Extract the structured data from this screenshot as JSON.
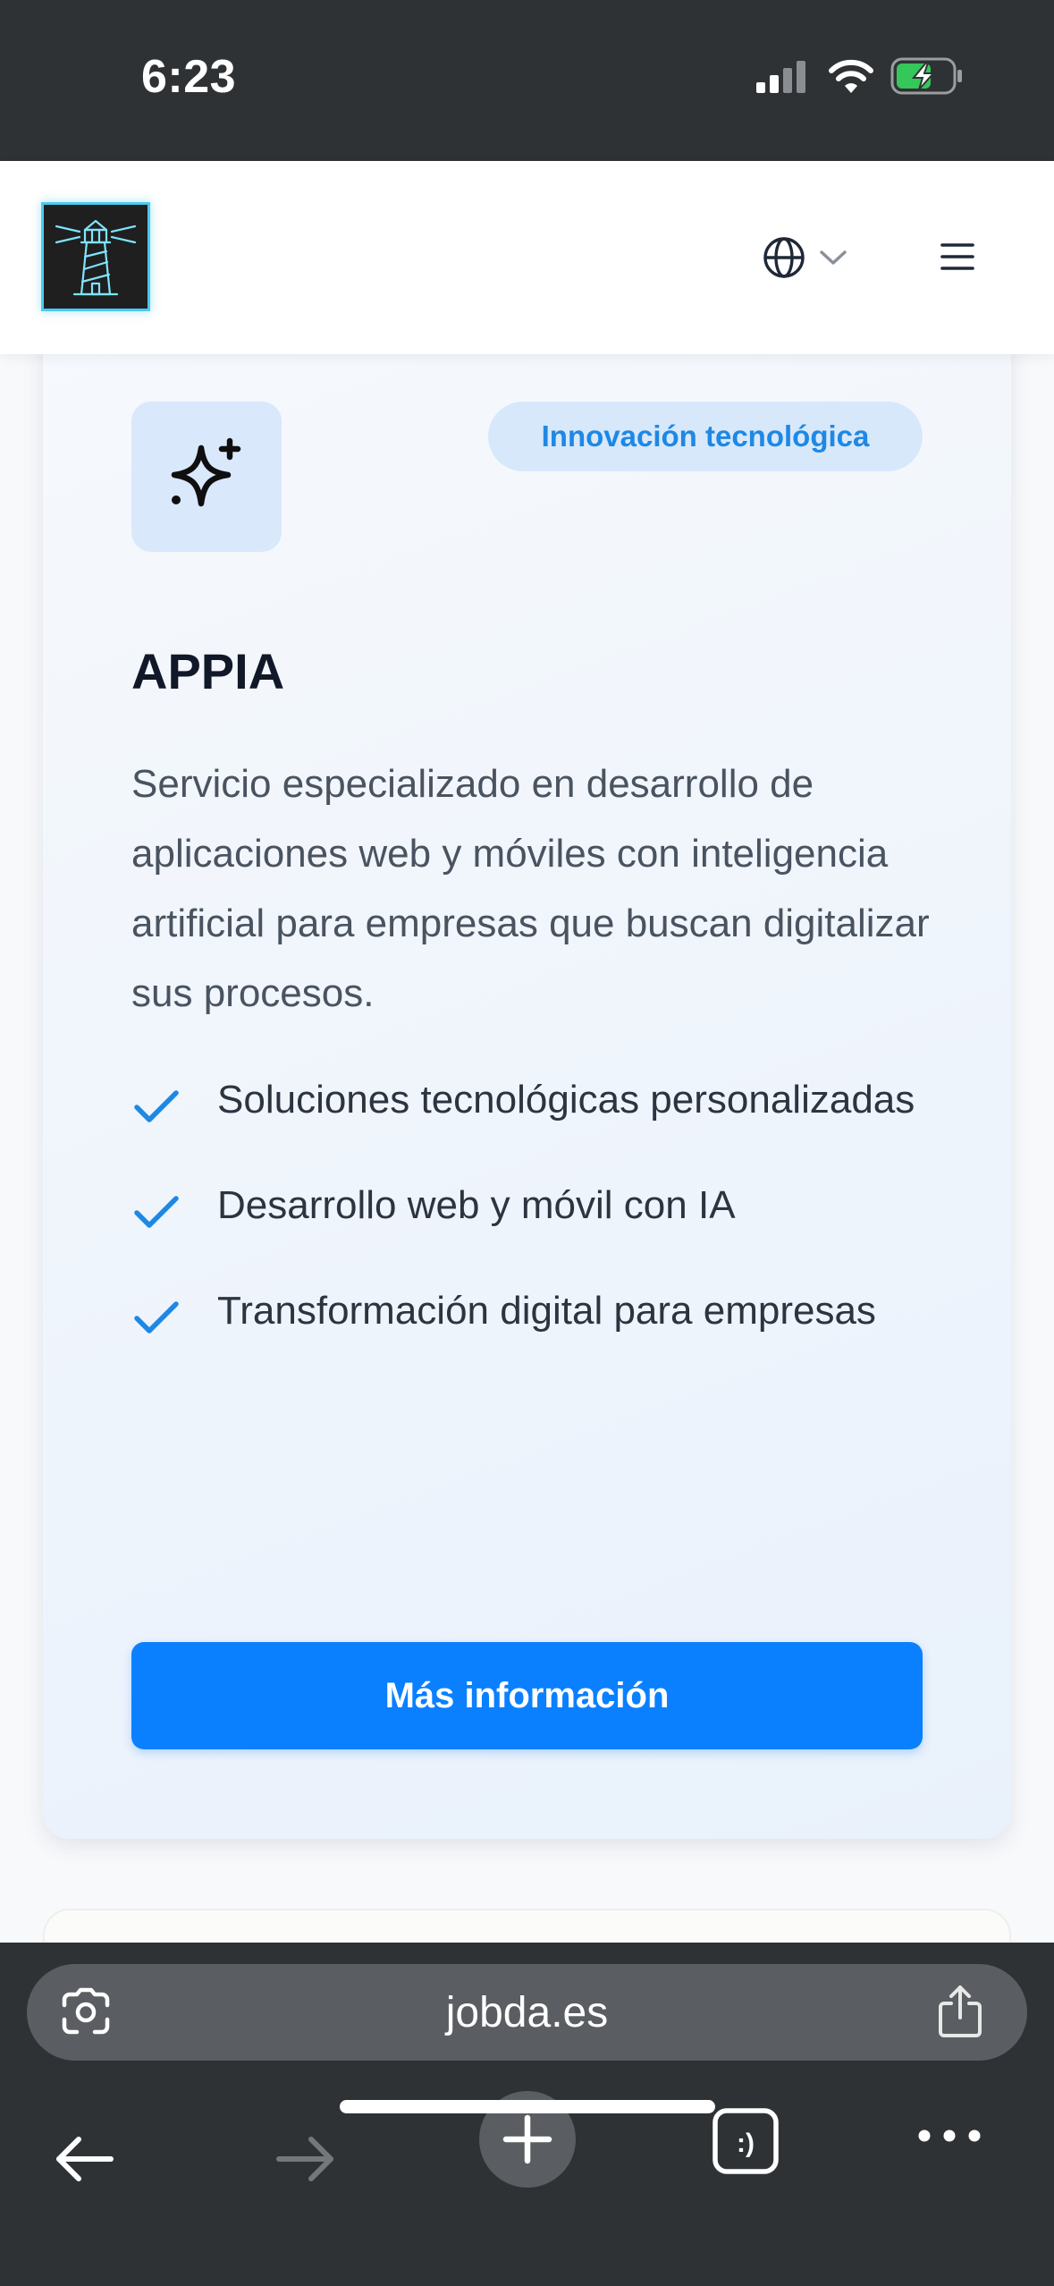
{
  "status_bar": {
    "time": "6:23"
  },
  "header": {
    "logo_icon": "lighthouse-logo",
    "language_icon": "globe-icon",
    "menu_icon": "hamburger-menu-icon"
  },
  "card": {
    "icon": "sparkles-icon",
    "badge": "Innovación tecnológica",
    "title": "APPIA",
    "description": "Servicio especializado en desarrollo de aplicaciones web y móviles con inteligencia artificial para empresas que buscan digitalizar sus procesos.",
    "features": [
      "Soluciones tecnológicas personalizadas",
      "Desarrollo web y móvil con IA",
      "Transformación digital para empresas"
    ],
    "cta_label": "Más información"
  },
  "browser": {
    "url": "jobda.es",
    "tabs_label": ":)"
  },
  "colors": {
    "accent": "#0a80ff",
    "badge_text": "#1e88e5",
    "check": "#1e88e5",
    "chrome_dark": "#2f3235"
  }
}
